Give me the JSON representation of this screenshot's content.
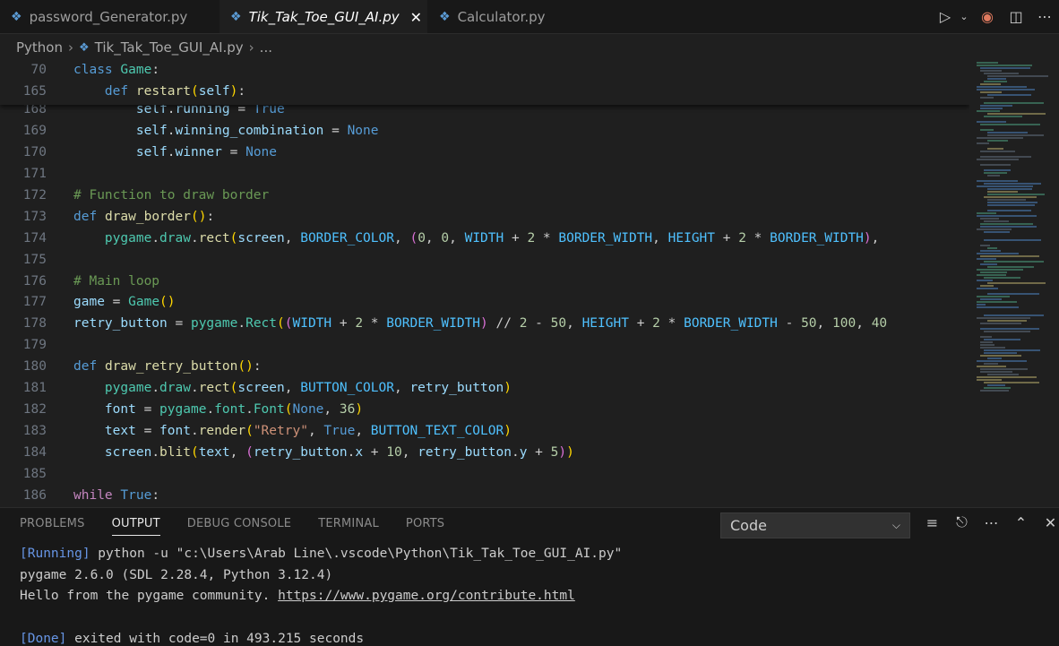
{
  "tabs": [
    {
      "label": "password_Generator.py",
      "active": false
    },
    {
      "label": "Tik_Tak_Toe_GUI_AI.py",
      "active": true,
      "close": "✕"
    },
    {
      "label": "Calculator.py",
      "active": false
    }
  ],
  "tab_actions": [
    "run-icon",
    "chevron-down-icon",
    "copilot-icon",
    "split-editor-icon",
    "more-icon"
  ],
  "breadcrumb": {
    "lang": "Python",
    "file": "Tik_Tak_Toe_GUI_AI.py",
    "more": "..."
  },
  "editor": {
    "sticky": [
      {
        "n": "70",
        "text": "class Game:"
      },
      {
        "n": "165",
        "text": "    def restart(self):"
      }
    ],
    "lines": [
      {
        "n": "168",
        "text": "        self.running = True"
      },
      {
        "n": "169",
        "text": "        self.winning_combination = None"
      },
      {
        "n": "170",
        "text": "        self.winner = None"
      },
      {
        "n": "171",
        "text": ""
      },
      {
        "n": "172",
        "text": "# Function to draw border"
      },
      {
        "n": "173",
        "text": "def draw_border():"
      },
      {
        "n": "174",
        "text": "    pygame.draw.rect(screen, BORDER_COLOR, (0, 0, WIDTH + 2 * BORDER_WIDTH, HEIGHT + 2 * BORDER_WIDTH),"
      },
      {
        "n": "175",
        "text": ""
      },
      {
        "n": "176",
        "text": "# Main loop"
      },
      {
        "n": "177",
        "text": "game = Game()"
      },
      {
        "n": "178",
        "text": "retry_button = pygame.Rect((WIDTH + 2 * BORDER_WIDTH) // 2 - 50, HEIGHT + 2 * BORDER_WIDTH - 50, 100, 40"
      },
      {
        "n": "179",
        "text": ""
      },
      {
        "n": "180",
        "text": "def draw_retry_button():"
      },
      {
        "n": "181",
        "text": "    pygame.draw.rect(screen, BUTTON_COLOR, retry_button)"
      },
      {
        "n": "182",
        "text": "    font = pygame.font.Font(None, 36)"
      },
      {
        "n": "183",
        "text": "    text = font.render(\"Retry\", True, BUTTON_TEXT_COLOR)"
      },
      {
        "n": "184",
        "text": "    screen.blit(text, (retry_button.x + 10, retry_button.y + 5))"
      },
      {
        "n": "185",
        "text": ""
      },
      {
        "n": "186",
        "text": "while True:"
      }
    ]
  },
  "panel": {
    "tabs": [
      "PROBLEMS",
      "OUTPUT",
      "DEBUG CONSOLE",
      "TERMINAL",
      "PORTS"
    ],
    "active_tab": "OUTPUT",
    "dropdown": "Code",
    "actions": [
      "list-filter-icon",
      "lock-icon",
      "more-icon",
      "chevron-up-icon",
      "close-icon"
    ],
    "output": {
      "running_tag": "[Running]",
      "running_cmd": " python -u \"c:\\Users\\Arab Line\\.vscode\\Python\\Tik_Tak_Toe_GUI_AI.py\"",
      "line2": "pygame 2.6.0 (SDL 2.28.4, Python 3.12.4)",
      "line3_text": "Hello from the pygame community. ",
      "line3_link": "https://www.pygame.org/contribute.html",
      "done_tag": "[Done]",
      "done_text": " exited with code=0 in 493.215 seconds"
    }
  }
}
